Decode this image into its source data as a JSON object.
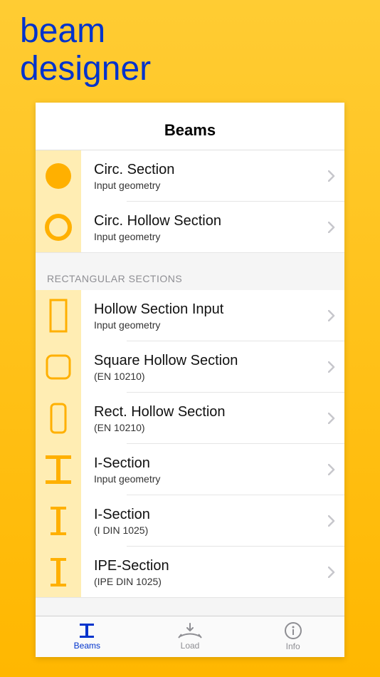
{
  "app": {
    "title_line1": "beam",
    "title_line2": "designer"
  },
  "header": {
    "title": "Beams"
  },
  "groups": [
    {
      "header": null,
      "items": [
        {
          "icon": "circle-solid",
          "title": "Circ. Section",
          "subtitle": "Input geometry"
        },
        {
          "icon": "circle-hollow",
          "title": "Circ. Hollow Section",
          "subtitle": "Input geometry"
        }
      ]
    },
    {
      "header": "RECTANGULAR SECTIONS",
      "items": [
        {
          "icon": "rect-hollow-tall",
          "title": "Hollow Section Input",
          "subtitle": "Input geometry"
        },
        {
          "icon": "rect-hollow-square-rounded",
          "title": "Square Hollow Section",
          "subtitle": "(EN 10210)"
        },
        {
          "icon": "rect-hollow-tall-rounded",
          "title": "Rect. Hollow Section",
          "subtitle": "(EN 10210)"
        },
        {
          "icon": "i-section-wide",
          "title": "I-Section",
          "subtitle": "Input geometry"
        },
        {
          "icon": "i-section-narrow",
          "title": "I-Section",
          "subtitle": "(I DIN 1025)"
        },
        {
          "icon": "i-section-narrow",
          "title": "IPE-Section",
          "subtitle": "(IPE DIN 1025)"
        }
      ]
    }
  ],
  "tabs": [
    {
      "icon": "tab-beams",
      "label": "Beams",
      "active": true
    },
    {
      "icon": "tab-load",
      "label": "Load",
      "active": false
    },
    {
      "icon": "tab-info",
      "label": "Info",
      "active": false
    }
  ],
  "colors": {
    "accent": "#0033cc",
    "iconFill": "#ffb000",
    "iconCellBg": "#ffedb3"
  }
}
